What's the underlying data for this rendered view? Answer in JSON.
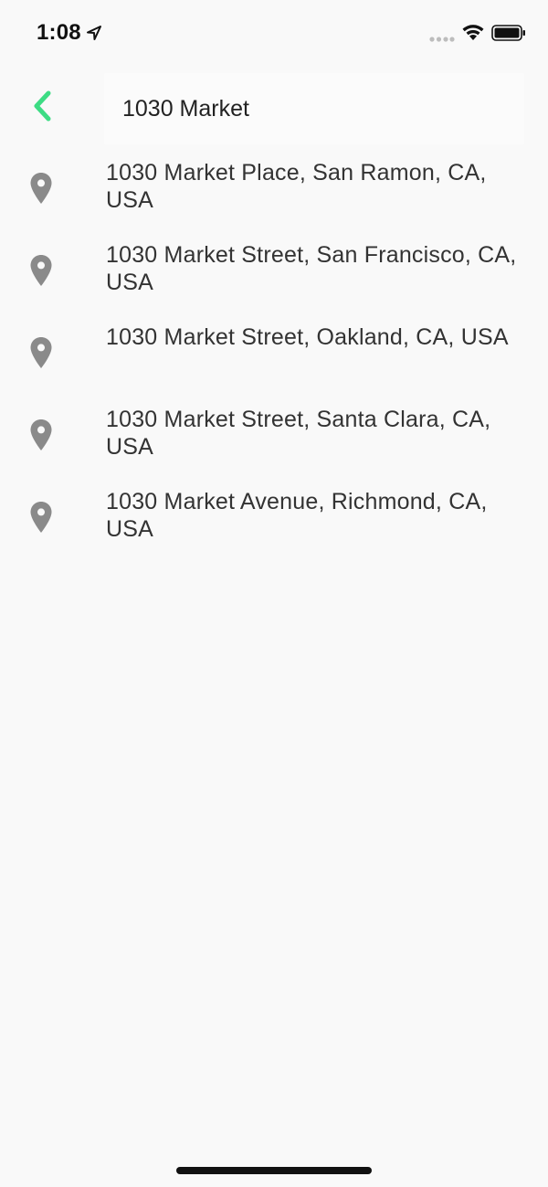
{
  "status_bar": {
    "time": "1:08",
    "location_icon": "location-arrow-icon",
    "signal_icon": "signal-dots-icon",
    "wifi_icon": "wifi-icon",
    "battery_icon": "battery-icon"
  },
  "header": {
    "back_icon": "chevron-left-icon",
    "search_value": "1030 Market",
    "accent_color": "#3ddc84"
  },
  "results": [
    {
      "label": "1030 Market Place, San Ramon, CA, USA",
      "icon": "map-pin-icon"
    },
    {
      "label": "1030 Market Street, San Francisco, CA, USA",
      "icon": "map-pin-icon"
    },
    {
      "label": "1030 Market Street, Oakland, CA, USA",
      "icon": "map-pin-icon"
    },
    {
      "label": "1030 Market Street, Santa Clara, CA, USA",
      "icon": "map-pin-icon"
    },
    {
      "label": "1030 Market Avenue, Richmond, CA, USA",
      "icon": "map-pin-icon"
    }
  ],
  "colors": {
    "background": "#f9f9f9",
    "pin": "#8a8a8a",
    "text": "#333333"
  }
}
